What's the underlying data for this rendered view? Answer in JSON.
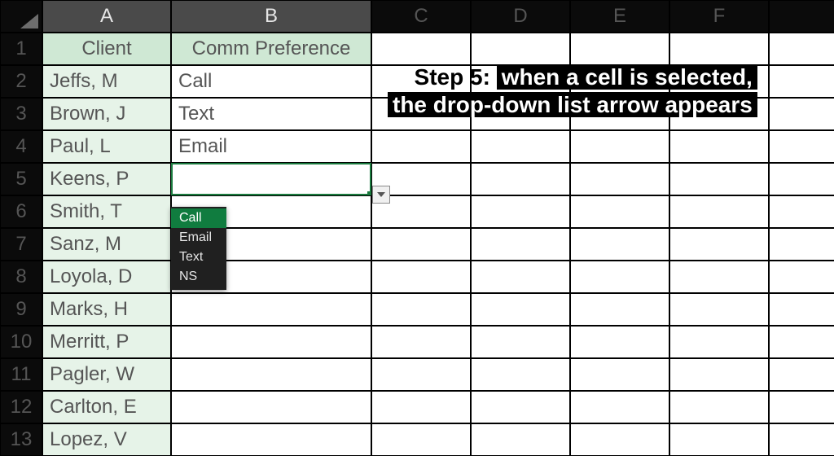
{
  "columns": [
    "A",
    "B",
    "C",
    "D",
    "E",
    "F"
  ],
  "active_columns": [
    "A",
    "B"
  ],
  "row_numbers": [
    "1",
    "2",
    "3",
    "4",
    "5",
    "6",
    "7",
    "8",
    "9",
    "10",
    "11",
    "12",
    "13"
  ],
  "headers": {
    "col_a": "Client",
    "col_b": "Comm Preference"
  },
  "rows": [
    {
      "client": "Jeffs, M",
      "comm": "Call"
    },
    {
      "client": "Brown, J",
      "comm": "Text"
    },
    {
      "client": "Paul, L",
      "comm": "Email"
    },
    {
      "client": "Keens, P",
      "comm": ""
    },
    {
      "client": "Smith, T",
      "comm": ""
    },
    {
      "client": "Sanz, M",
      "comm": ""
    },
    {
      "client": "Loyola, D",
      "comm": ""
    },
    {
      "client": "Marks, H",
      "comm": ""
    },
    {
      "client": "Merritt, P",
      "comm": ""
    },
    {
      "client": "Pagler, W",
      "comm": ""
    },
    {
      "client": "Carlton, E",
      "comm": ""
    },
    {
      "client": "Lopez, V",
      "comm": ""
    }
  ],
  "selected_cell": "B5",
  "dropdown": {
    "options": [
      "Call",
      "Email",
      "Text",
      "NS"
    ],
    "highlighted_index": 0
  },
  "caption": {
    "step_label": "Step 5:",
    "line1": "when a cell is selected,",
    "line2": "the drop-down list arrow appears"
  },
  "colors": {
    "accent_green": "#1a7a3e",
    "header_fill": "#cfe8d4",
    "client_fill": "#e6f3e8"
  }
}
